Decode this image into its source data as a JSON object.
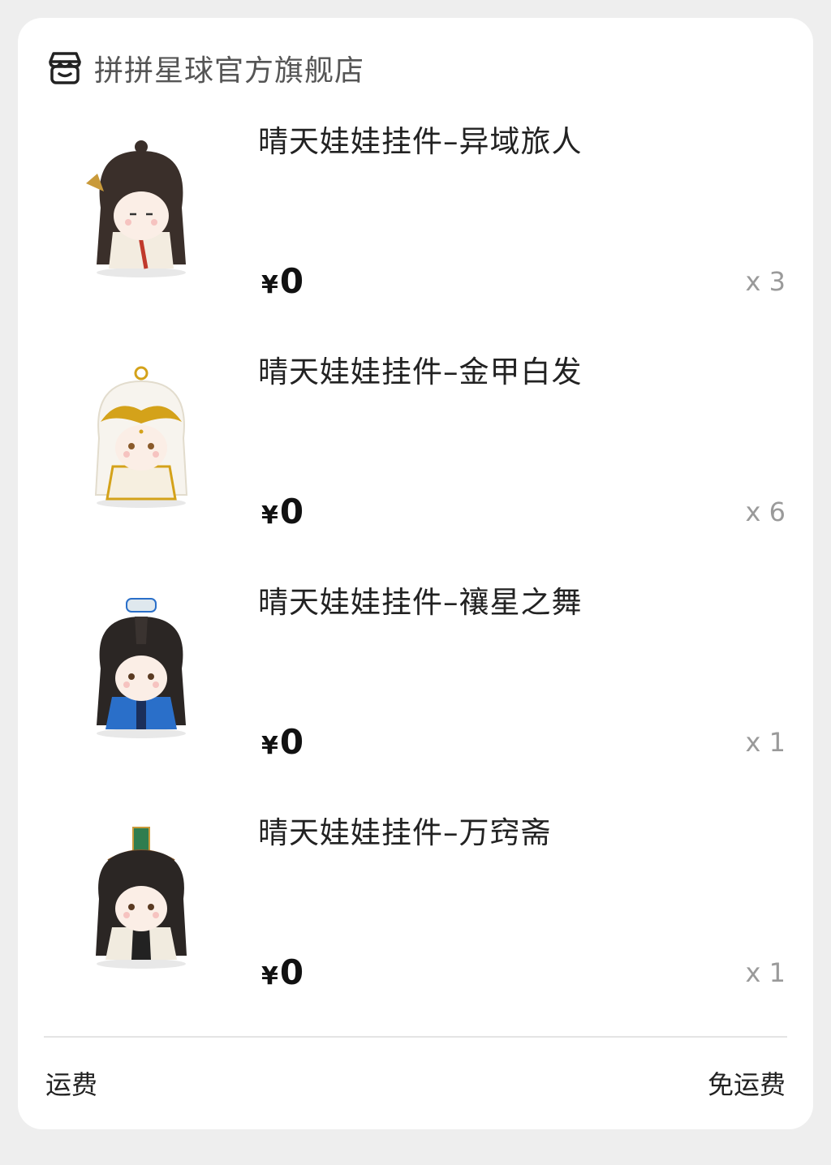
{
  "store": {
    "name": "拼拼星球官方旗舰店",
    "icon": "store-icon"
  },
  "items": [
    {
      "title": "晴天娃娃挂件–异域旅人",
      "currency": "¥",
      "price": "0",
      "qty": "x 3",
      "accent": "#c0392b"
    },
    {
      "title": "晴天娃娃挂件–金甲白发",
      "currency": "¥",
      "price": "0",
      "qty": "x 6",
      "accent": "#d4a21a"
    },
    {
      "title": "晴天娃娃挂件–禳星之舞",
      "currency": "¥",
      "price": "0",
      "qty": "x 1",
      "accent": "#2a6fc9"
    },
    {
      "title": "晴天娃娃挂件–万窍斋",
      "currency": "¥",
      "price": "0",
      "qty": "x 1",
      "accent": "#2f7d4f"
    }
  ],
  "shipping": {
    "label": "运费",
    "value": "免运费"
  }
}
